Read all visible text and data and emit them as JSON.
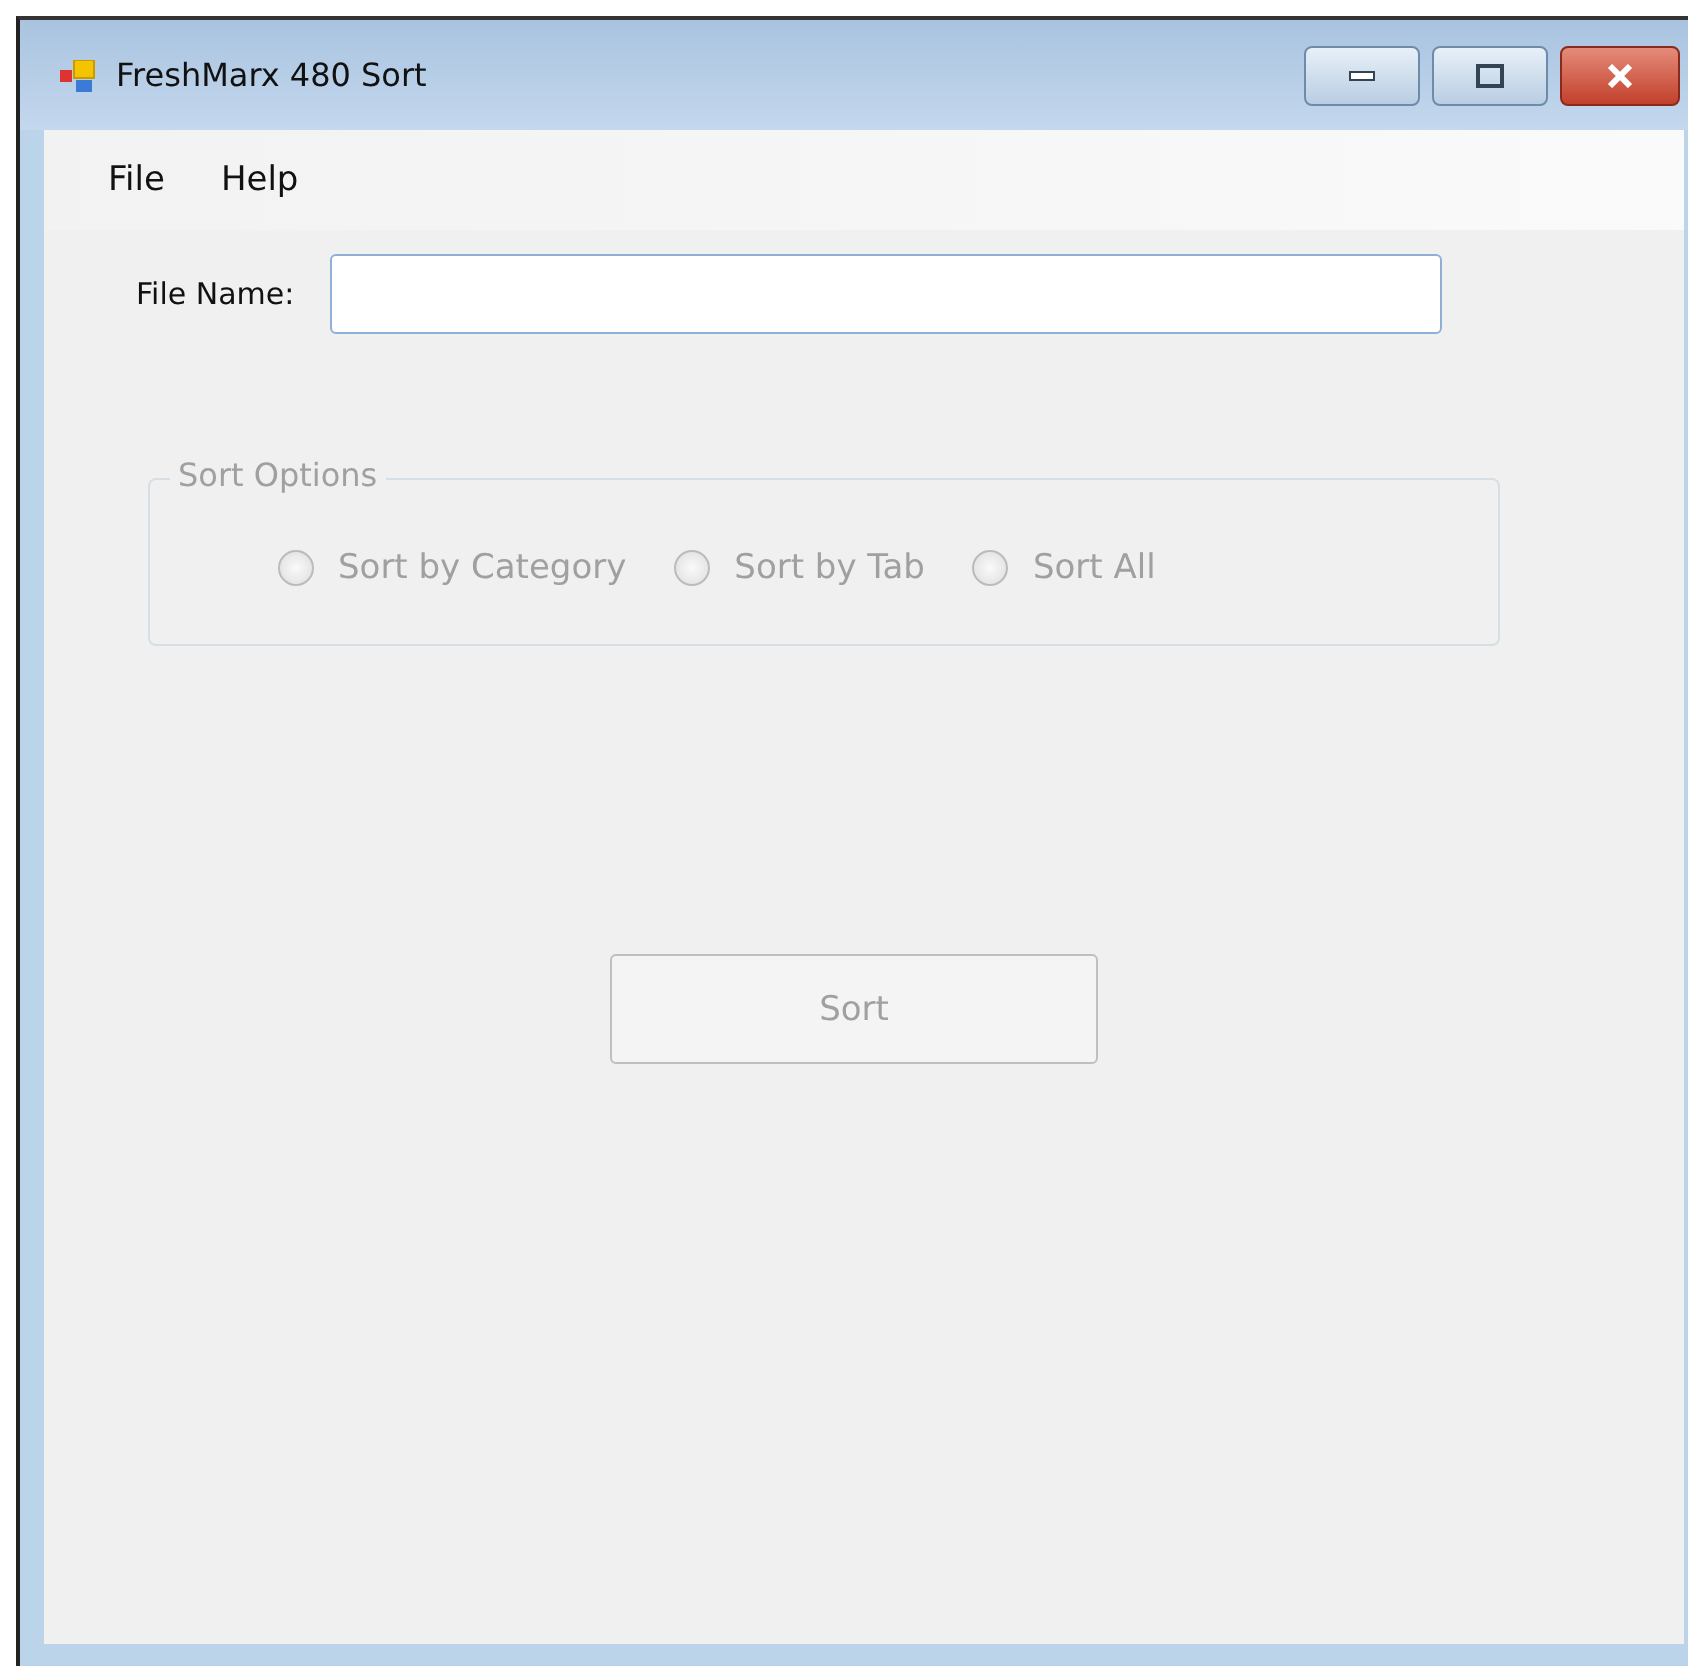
{
  "window": {
    "title": "FreshMarx 480 Sort"
  },
  "menu": [
    "File",
    "Help"
  ],
  "file_name": {
    "label": "File Name:"
  },
  "sort_options": {
    "title": "Sort Options",
    "disabled": true,
    "options": [
      {
        "label": "Sort by Category",
        "selected": false
      },
      {
        "label": "Sort by Tab",
        "selected": false
      },
      {
        "label": "Sort All",
        "selected": false
      }
    ]
  },
  "sort_button": {
    "label": "Sort",
    "disabled": true
  }
}
